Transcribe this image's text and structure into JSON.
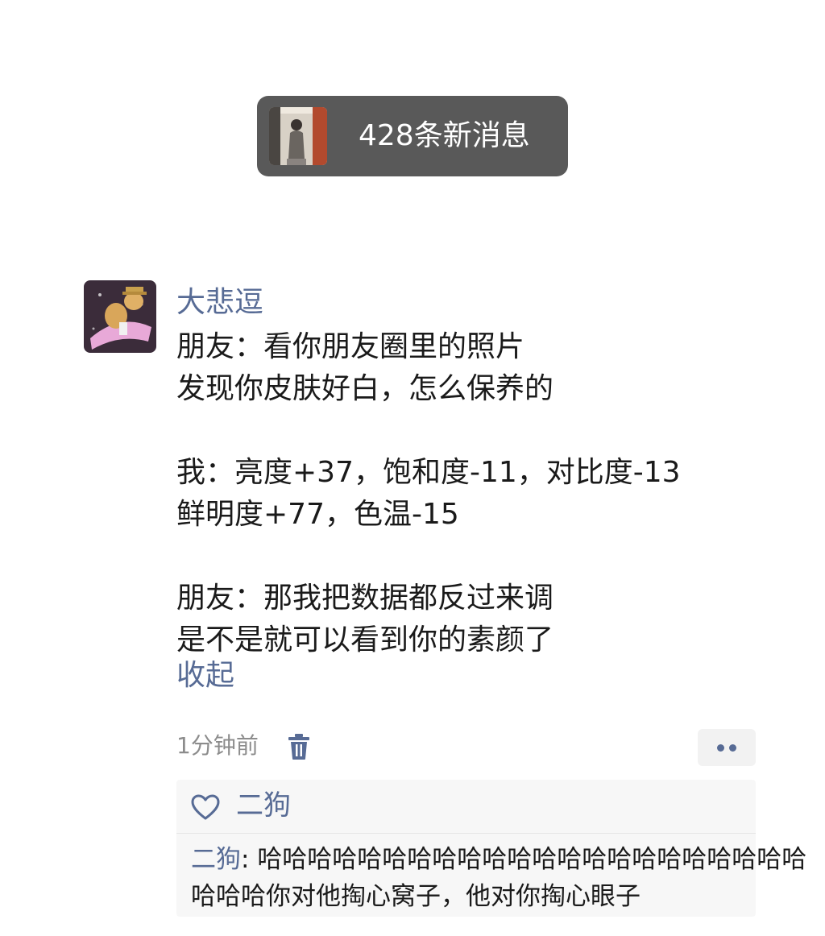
{
  "notification": {
    "text": "428条新消息",
    "thumbnail_icon": "person-photo-thumbnail"
  },
  "post": {
    "avatar_icon": "dog-avatar",
    "author": "大悲逗",
    "lines": [
      "朋友：看你朋友圈里的照片",
      "发现你皮肤好白，怎么保养的",
      "",
      "我：亮度+37，饱和度-11，对比度-13",
      "鲜明度+77，色温-15",
      "",
      "朋友：那我把数据都反过来调",
      "是不是就可以看到你的素颜了"
    ],
    "collapse_label": "收起",
    "time": "1分钟前",
    "delete_icon": "trash-icon",
    "more_icon": "more-dots-icon"
  },
  "interactions": {
    "like_icon": "heart-icon",
    "likes": "二狗",
    "comment": {
      "author": "二狗",
      "separator": ": ",
      "line1": "哈哈哈哈哈哈哈哈哈哈哈哈哈哈哈哈哈哈哈哈哈哈",
      "line2": "哈哈哈你对他掏心窝子，他对你掏心眼子"
    }
  },
  "colors": {
    "link": "#576b95",
    "text": "#1a1a1a",
    "meta": "#8c8c8c",
    "pill": "#595959",
    "panel": "#f7f7f7"
  }
}
